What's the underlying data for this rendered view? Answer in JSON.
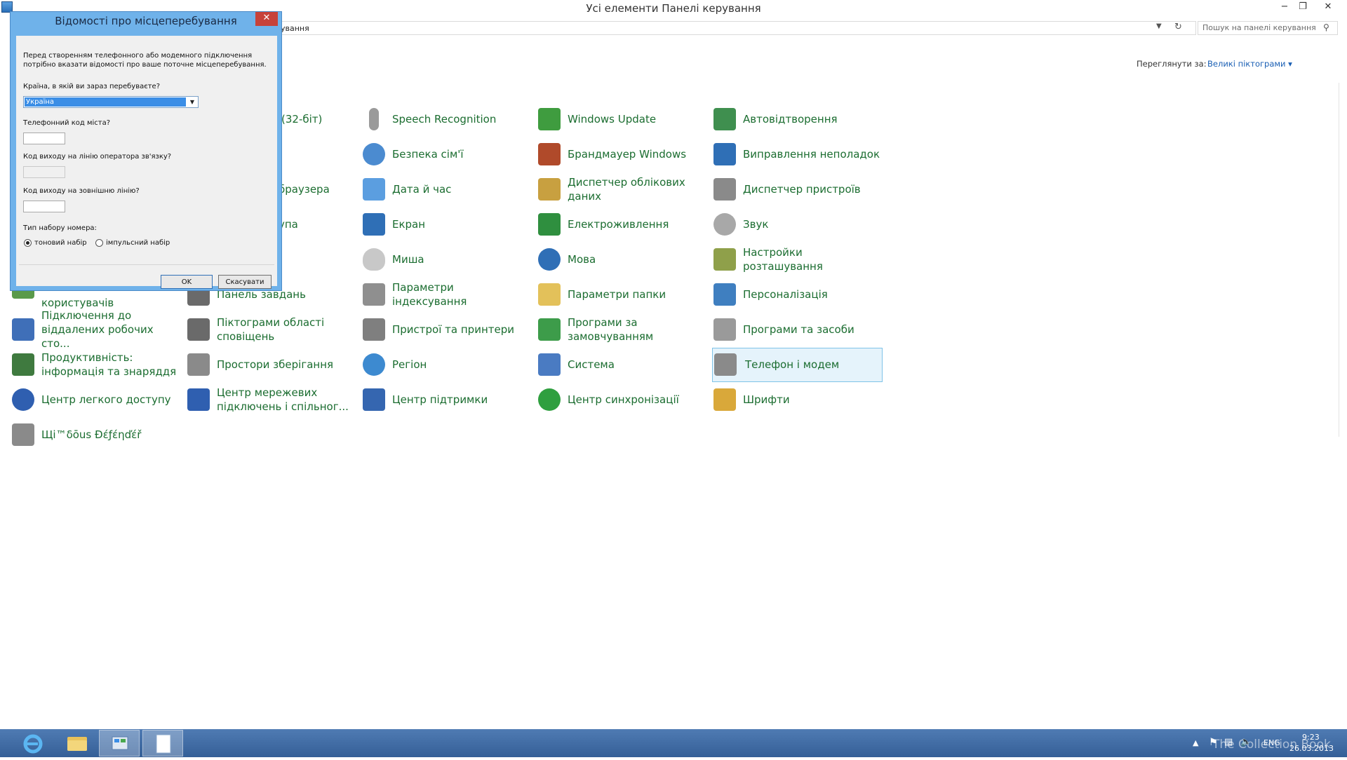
{
  "window": {
    "title": "Усі елементи Панелі керування",
    "minimize_glyph": "−",
    "restore_glyph": "❐",
    "close_glyph": "✕"
  },
  "address": {
    "path_text": "ування",
    "search_placeholder": "Пошук на панелі керування"
  },
  "view": {
    "label": "Переглянути за:",
    "value": "Великі піктограми ▾"
  },
  "items": [
    {
      "label": "(32-біт)",
      "icon": "flash-player-icon",
      "color": "#c43a2a"
    },
    {
      "label": "браузера",
      "icon": "internet-options-icon",
      "color": "#3b8ad8"
    },
    {
      "label": "упа",
      "icon": "remoteapp-icon",
      "color": "#4a78c2"
    },
    {
      "label": "Speech Recognition",
      "icon": "microphone-icon",
      "color": "#9a9a9a"
    },
    {
      "label": "Безпека сім'ї",
      "icon": "family-safety-icon",
      "color": "#4b8bd0"
    },
    {
      "label": "Дата й час",
      "icon": "calendar-clock-icon",
      "color": "#5b9ee0"
    },
    {
      "label": "Екран",
      "icon": "monitor-icon",
      "color": "#2f6fb6"
    },
    {
      "label": "Миша",
      "icon": "mouse-icon",
      "color": "#b8b8b8"
    },
    {
      "label": "Параметри індексування",
      "icon": "indexing-icon",
      "color": "#8f8f8f"
    },
    {
      "label": "Пристрої та принтери",
      "icon": "printer-icon",
      "color": "#7f7f7f"
    },
    {
      "label": "Регіон",
      "icon": "globe-clock-icon",
      "color": "#3d8ad0"
    },
    {
      "label": "Центр підтримки",
      "icon": "flag-icon",
      "color": "#3566b0"
    },
    {
      "label": "Windows Update",
      "icon": "windows-update-icon",
      "color": "#3f9c3f"
    },
    {
      "label": "Брандмауер Windows",
      "icon": "firewall-icon",
      "color": "#b04a2a"
    },
    {
      "label": "Диспетчер облікових даних",
      "icon": "credential-manager-icon",
      "color": "#c8a040"
    },
    {
      "label": "Електроживлення",
      "icon": "power-options-icon",
      "color": "#2f8f3f"
    },
    {
      "label": "Мова",
      "icon": "language-icon",
      "color": "#2f6fb6"
    },
    {
      "label": "Параметри папки",
      "icon": "folder-options-icon",
      "color": "#e3c15a"
    },
    {
      "label": "Програми за замовчуванням",
      "icon": "default-programs-icon",
      "color": "#3d9c4a"
    },
    {
      "label": "Система",
      "icon": "system-icon",
      "color": "#4a7bc2"
    },
    {
      "label": "Центр синхронізації",
      "icon": "sync-center-icon",
      "color": "#2f9f3f"
    },
    {
      "label": "Автовідтворення",
      "icon": "autoplay-icon",
      "color": "#3f8f4f"
    },
    {
      "label": "Виправлення неполадок",
      "icon": "troubleshooting-icon",
      "color": "#2f6fb6"
    },
    {
      "label": "Диспетчер пристроїв",
      "icon": "device-manager-icon",
      "color": "#8a8a8a"
    },
    {
      "label": "Звук",
      "icon": "speaker-icon",
      "color": "#a8a8a8"
    },
    {
      "label": "Настройки розташування",
      "icon": "location-settings-icon",
      "color": "#8fa04a"
    },
    {
      "label": "Персоналізація",
      "icon": "personalization-icon",
      "color": "#3f7fc0"
    },
    {
      "label": "Програми та засоби",
      "icon": "programs-features-icon",
      "color": "#9a9a9a"
    },
    {
      "label": "Телефон і модем",
      "icon": "phone-modem-icon",
      "color": "#8a8a8a"
    },
    {
      "label": "Шрифти",
      "icon": "fonts-icon",
      "color": "#d9a83a"
    },
    {
      "label": "користувачів",
      "icon": "user-accounts-icon",
      "color": "#5a9a4a"
    },
    {
      "label": "Підключення до віддалених робочих сто...",
      "icon": "remote-desktop-icon",
      "color": "#3f6fb8"
    },
    {
      "label": "Продуктивність: інформація та знаряддя",
      "icon": "performance-icon",
      "color": "#3f7a3f"
    },
    {
      "label": "Центр легкого доступу",
      "icon": "ease-of-access-icon",
      "color": "#2f5fb0"
    },
    {
      "label": "Щі™δōus Ðέƒέηďέř",
      "icon": "defender-icon",
      "color": "#8a8a8a"
    },
    {
      "label": "Панель завдань",
      "icon": "taskbar-icon",
      "color": "#6a6a6a"
    },
    {
      "label": "Піктограми області сповіщень",
      "icon": "notification-icons-icon",
      "color": "#6a6a6a"
    },
    {
      "label": "Простори зберігання",
      "icon": "storage-spaces-icon",
      "color": "#8a8a8a"
    },
    {
      "label": "Центр мережевих підключень і спільног...",
      "icon": "network-center-icon",
      "color": "#2f5fb0"
    }
  ],
  "dialog": {
    "title": "Відомості про місцеперебування",
    "intro": "Перед створенням телефонного або модемного підключення потрібно вказати відомості про ваше поточне місцеперебування.",
    "country_label": "Країна, в якій ви зараз перебуваєте?",
    "country_value": "Україна",
    "area_code_label": "Телефонний код міста?",
    "carrier_code_label": "Код виходу на лінію оператора зв'язку?",
    "outside_line_label": "Код виходу на зовнішню лінію?",
    "dial_type_label": "Тип набору номера:",
    "tone_label": "тоновий набір",
    "pulse_label": "імпульсний набір",
    "ok_label": "OK",
    "cancel_label": "Скасувати",
    "close_glyph": "✕"
  },
  "taskbar": {
    "lang": "ENG",
    "time": "9:23",
    "date": "26.03.2013",
    "watermark": "The Collection Book"
  }
}
